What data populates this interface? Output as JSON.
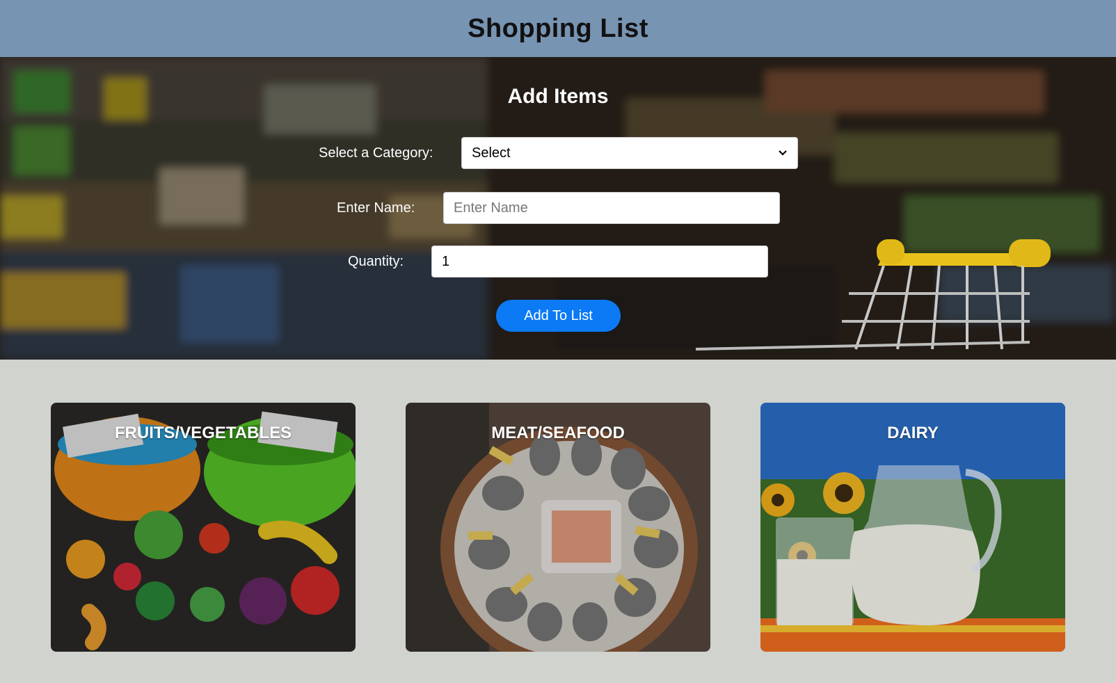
{
  "header": {
    "title": "Shopping List"
  },
  "form": {
    "title": "Add Items",
    "category_label": "Select a Category:",
    "category_value": "Select",
    "name_label": "Enter Name:",
    "name_placeholder": "Enter Name",
    "quantity_label": "Quantity:",
    "quantity_value": "1",
    "submit_label": "Add To List"
  },
  "categories": [
    {
      "title": "FRUITS/VEGETABLES",
      "image": "toy-fruits-vegetables-baskets"
    },
    {
      "title": "MEAT/SEAFOOD",
      "image": "oysters-platter"
    },
    {
      "title": "DAIRY",
      "image": "milk-jug-and-glass"
    }
  ],
  "colors": {
    "header_bg": "#7894b3",
    "page_bg": "#d0d3ce",
    "button_bg": "#0b7af4"
  }
}
